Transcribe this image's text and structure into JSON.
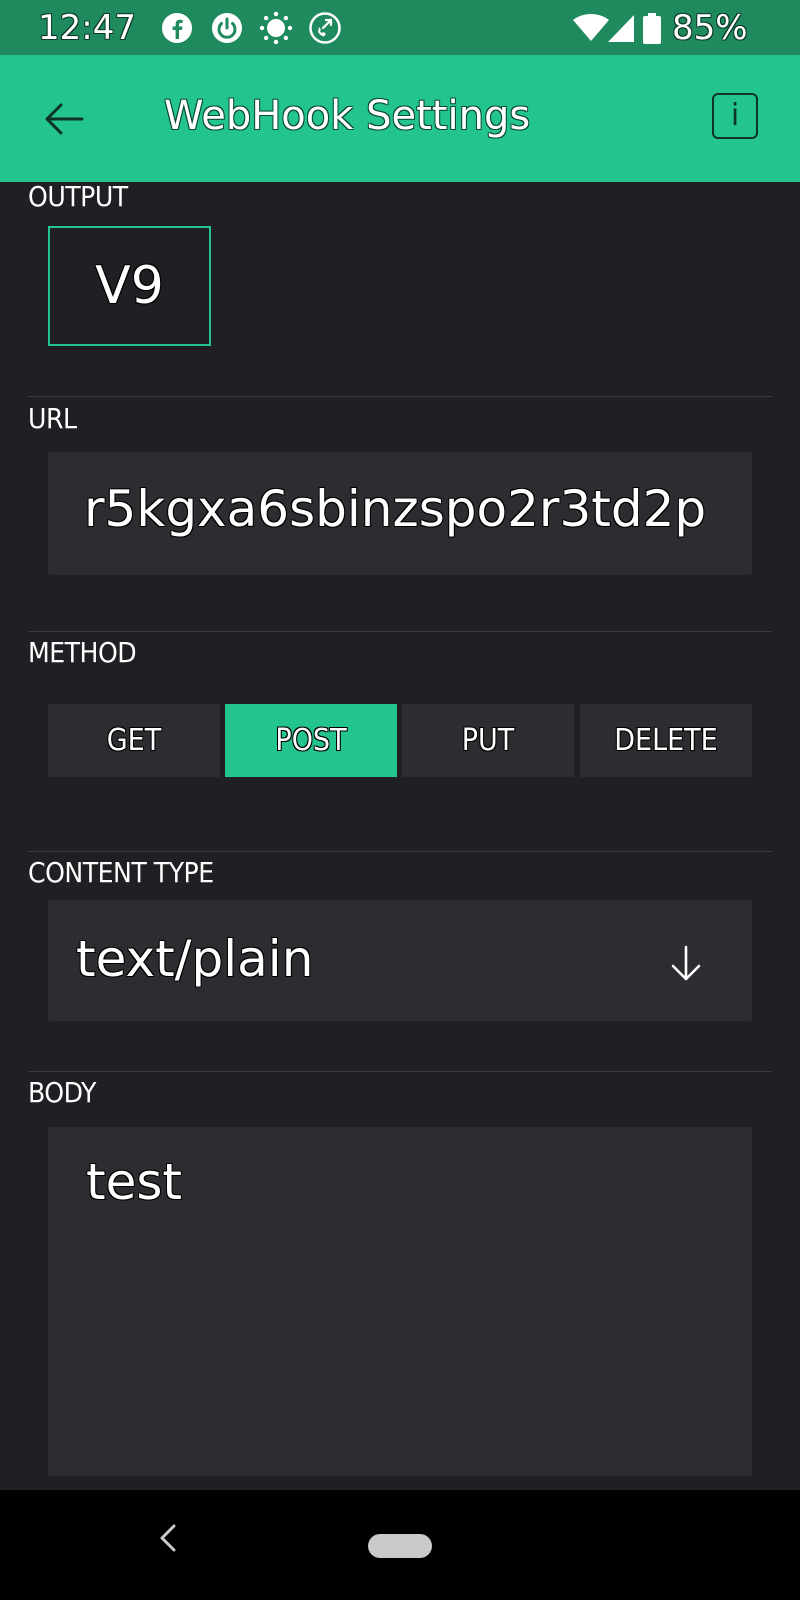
{
  "status_bar": {
    "time": "12:47",
    "battery_percent": "85%",
    "icons": [
      "facebook-icon",
      "power-icon",
      "brightness-icon",
      "phone-forward-icon",
      "wifi-icon",
      "signal-icon",
      "battery-icon"
    ]
  },
  "app_bar": {
    "title": "WebHook Settings",
    "info_label": "i"
  },
  "output": {
    "label": "OUTPUT",
    "pin": "V9"
  },
  "url": {
    "label": "URL",
    "value": "r5kgxa6sbinzspo2r3td2p"
  },
  "method": {
    "label": "METHOD",
    "options": [
      "GET",
      "POST",
      "PUT",
      "DELETE"
    ],
    "selected": "POST"
  },
  "content_type": {
    "label": "CONTENT TYPE",
    "value": "text/plain"
  },
  "body": {
    "label": "BODY",
    "value": "test"
  },
  "colors": {
    "accent": "#23c48e",
    "status_bar": "#1e8a5e",
    "background": "#1f2023",
    "field": "#2c2d31"
  }
}
